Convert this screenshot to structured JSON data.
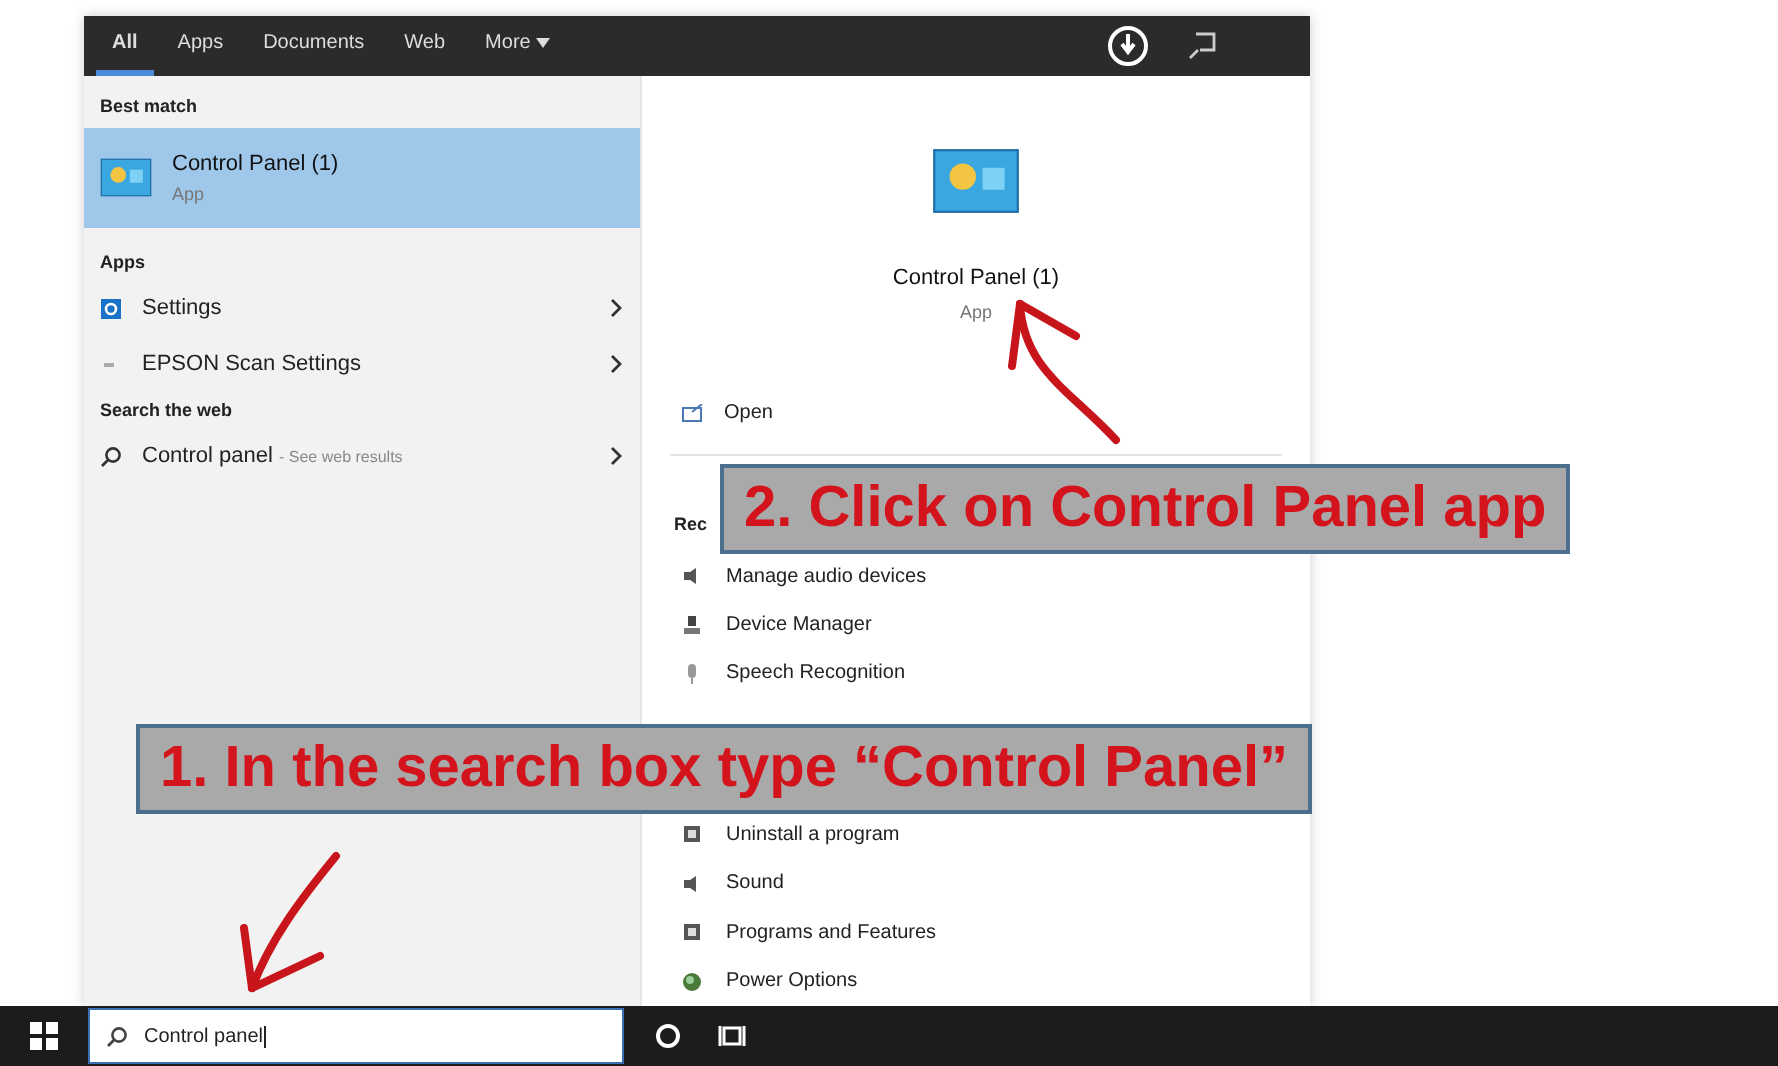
{
  "search_tabs": [
    {
      "label": "All",
      "selected": true
    },
    {
      "label": "Apps",
      "selected": false
    },
    {
      "label": "Documents",
      "selected": false
    },
    {
      "label": "Web",
      "selected": false
    },
    {
      "label": "More",
      "selected": false
    }
  ],
  "best_match": {
    "heading": "Best match",
    "title": "Control Panel (1)",
    "subtitle": "App",
    "selected": true
  },
  "apps": {
    "heading": "Apps",
    "items": [
      {
        "label": "Settings"
      },
      {
        "label": "EPSON Scan Settings"
      }
    ]
  },
  "web": {
    "heading": "Search the web",
    "query": "Control panel",
    "hint": "- See web results"
  },
  "preview": {
    "title": "Control Panel (1)",
    "subtitle": "App",
    "actions": [
      "Open"
    ],
    "recent_heading": "Rec",
    "recent": [
      {
        "label": "Manage audio devices"
      },
      {
        "label": "Device Manager"
      },
      {
        "label": "Speech Recognition"
      },
      {
        "label": "Uninstall a program"
      },
      {
        "label": "Sound"
      },
      {
        "label": "Programs and Features"
      },
      {
        "label": "Power Options"
      }
    ]
  },
  "taskbar": {
    "search": {
      "value": "Control panel"
    }
  },
  "callouts": [
    {
      "text": "2. Click on Control Panel app"
    },
    {
      "text": "1. In the search box type “Control Panel”"
    }
  ]
}
